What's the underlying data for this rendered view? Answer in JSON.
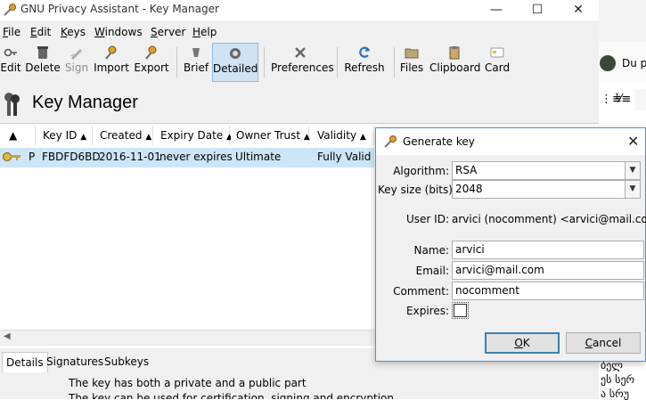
{
  "window": {
    "title": "GNU Privacy Assistant - Key Manager",
    "controls": [
      "—",
      "☐",
      "✕"
    ]
  },
  "menubar": {
    "items": [
      {
        "first": "F",
        "rest": "ile"
      },
      {
        "first": "E",
        "rest": "dit"
      },
      {
        "first": "K",
        "rest": "eys"
      },
      {
        "first": "W",
        "rest": "indows"
      },
      {
        "first": "S",
        "rest": "erver"
      },
      {
        "first": "H",
        "rest": "elp"
      }
    ]
  },
  "toolbar": {
    "edit": "Edit",
    "delete": "Delete",
    "sign": "Sign",
    "import": "Import",
    "export": "Export",
    "brief": "Brief",
    "detailed": "Detailed",
    "preferences": "Preferences",
    "refresh": "Refresh",
    "files": "Files",
    "clipboard": "Clipboard",
    "card": "Card"
  },
  "heading": "Key Manager",
  "keylist": {
    "columns": [
      "Key ID",
      "Created",
      "Expiry Date",
      "Owner Trust",
      "Validity"
    ],
    "rows": [
      {
        "type": "P",
        "key_id": "FBDFD6BD",
        "created": "2016-11-01",
        "expiry": "never expires",
        "owner_trust": "Ultimate",
        "validity": "Fully Valid"
      }
    ]
  },
  "details": {
    "tabs": [
      "Details",
      "Signatures",
      "Subkeys"
    ],
    "lines": [
      "The key has both a private and a public part",
      "The key can be used for certification, signing and encryption."
    ]
  },
  "background_window": {
    "snippet": "Du po",
    "text_lines": [
      "ბელ",
      "ეს სერ",
      "ა სრუ"
    ]
  },
  "dialog": {
    "title": "Generate key",
    "algorithm_label": "Algorithm:",
    "algorithm_value": "RSA",
    "keysize_label": "Key size (bits):",
    "keysize_value": "2048",
    "userid_label": "User ID:",
    "userid_value": "arvici (nocomment) <arvici@mail.com>",
    "name_label": "Name:",
    "name_value": "arvici",
    "email_label": "Email:",
    "email_value": "arvici@mail.com",
    "comment_label": "Comment:",
    "comment_value": "nocomment",
    "expires_label": "Expires:",
    "ok_first": "O",
    "ok_rest": "K",
    "cancel_first": "C",
    "cancel_rest": "ancel"
  }
}
